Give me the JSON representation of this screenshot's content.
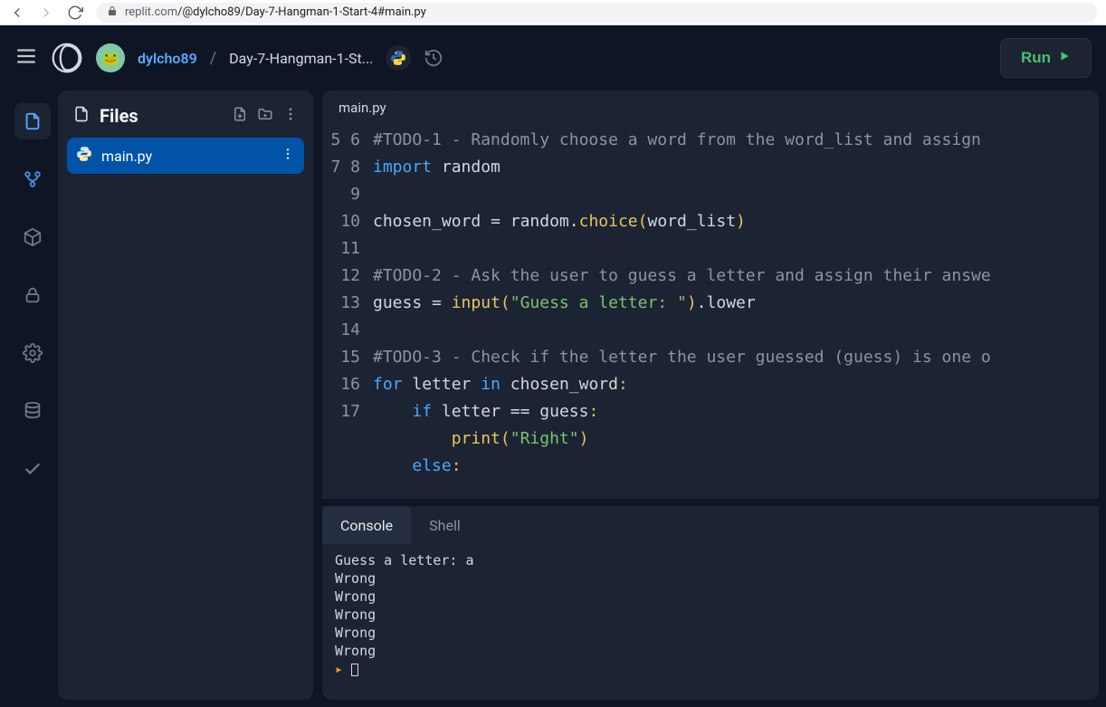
{
  "browser": {
    "url_host": "replit.com",
    "url_path": "/@dylcho89/Day-7-Hangman-1-Start-4#main.py"
  },
  "header": {
    "username": "dylcho89",
    "project": "Day-7-Hangman-1-St...",
    "run_label": "Run"
  },
  "files": {
    "title": "Files",
    "items": [
      {
        "name": "main.py"
      }
    ]
  },
  "editor": {
    "tab": "main.py",
    "first_line_no": 5,
    "lines": [
      {
        "n": 5,
        "tokens": [
          [
            "cm",
            "#TODO-1 - Randomly choose a word from the word_list and assign"
          ]
        ]
      },
      {
        "n": 6,
        "tokens": [
          [
            "kw",
            "import"
          ],
          [
            "sp",
            " "
          ],
          [
            "id",
            "random"
          ]
        ]
      },
      {
        "n": 7,
        "tokens": []
      },
      {
        "n": 8,
        "tokens": [
          [
            "id",
            "chosen_word"
          ],
          [
            "sp",
            " "
          ],
          [
            "op",
            "="
          ],
          [
            "sp",
            " "
          ],
          [
            "id",
            "random"
          ],
          [
            "op",
            "."
          ],
          [
            "fn",
            "choice"
          ],
          [
            "pn",
            "("
          ],
          [
            "id",
            "word_list"
          ],
          [
            "pn",
            ")"
          ]
        ]
      },
      {
        "n": 9,
        "tokens": []
      },
      {
        "n": 10,
        "tokens": [
          [
            "cm",
            "#TODO-2 - Ask the user to guess a letter and assign their answe"
          ]
        ]
      },
      {
        "n": 11,
        "tokens": [
          [
            "id",
            "guess"
          ],
          [
            "sp",
            " "
          ],
          [
            "op",
            "="
          ],
          [
            "sp",
            " "
          ],
          [
            "fn",
            "input"
          ],
          [
            "pn",
            "("
          ],
          [
            "str",
            "\"Guess a letter: \""
          ],
          [
            "pn",
            ")"
          ],
          [
            "op",
            "."
          ],
          [
            "id",
            "lower"
          ]
        ]
      },
      {
        "n": 12,
        "tokens": []
      },
      {
        "n": 13,
        "tokens": [
          [
            "cm",
            "#TODO-3 - Check if the letter the user guessed (guess) is one o"
          ]
        ]
      },
      {
        "n": 14,
        "tokens": [
          [
            "kw",
            "for"
          ],
          [
            "sp",
            " "
          ],
          [
            "id",
            "letter"
          ],
          [
            "sp",
            " "
          ],
          [
            "kw",
            "in"
          ],
          [
            "sp",
            " "
          ],
          [
            "id",
            "chosen_word"
          ],
          [
            "pn",
            ":"
          ]
        ]
      },
      {
        "n": 15,
        "tokens": [
          [
            "sp",
            "    "
          ],
          [
            "kw",
            "if"
          ],
          [
            "sp",
            " "
          ],
          [
            "id",
            "letter"
          ],
          [
            "sp",
            " "
          ],
          [
            "op",
            "=="
          ],
          [
            "sp",
            " "
          ],
          [
            "id",
            "guess"
          ],
          [
            "pn",
            ":"
          ]
        ]
      },
      {
        "n": 16,
        "tokens": [
          [
            "sp",
            "        "
          ],
          [
            "fn",
            "print"
          ],
          [
            "pn",
            "("
          ],
          [
            "str",
            "\"Right\""
          ],
          [
            "pn",
            ")"
          ]
        ]
      },
      {
        "n": 17,
        "tokens": [
          [
            "sp",
            "    "
          ],
          [
            "kw",
            "else"
          ],
          [
            "pn",
            ":"
          ]
        ]
      }
    ]
  },
  "terminal": {
    "tabs": {
      "console": "Console",
      "shell": "Shell"
    },
    "lines": [
      "Guess a letter: a",
      "Wrong",
      "Wrong",
      "Wrong",
      "Wrong",
      "Wrong"
    ]
  }
}
